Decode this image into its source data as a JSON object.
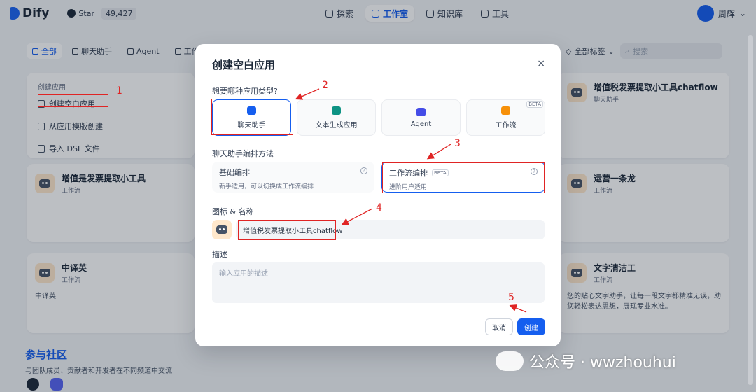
{
  "brand": {
    "name": "Dify",
    "star_label": "Star",
    "star_count": "49,427"
  },
  "nav": [
    {
      "label": "探索",
      "active": false
    },
    {
      "label": "工作室",
      "active": true
    },
    {
      "label": "知识库",
      "active": false
    },
    {
      "label": "工具",
      "active": false
    }
  ],
  "user": {
    "name": "周辉"
  },
  "filters": [
    {
      "label": "全部",
      "active": true
    },
    {
      "label": "聊天助手",
      "active": false
    },
    {
      "label": "Agent",
      "active": false
    },
    {
      "label": "工作流",
      "active": false
    }
  ],
  "tags_label": "全部标签",
  "search_placeholder": "搜索",
  "create_card": {
    "title": "创建应用",
    "options": [
      "创建空白应用",
      "从应用模版创建",
      "导入 DSL 文件"
    ]
  },
  "apps": {
    "a1": {
      "name": "增值是发票提取小工具",
      "type": "工作流"
    },
    "a2": {
      "name": "中译英",
      "type": "工作流",
      "desc": "中译英"
    },
    "a3": {
      "name": "增值税发票提取小工具chatflow",
      "type": "聊天助手"
    },
    "a4": {
      "name": "运营一条龙",
      "type": "工作流"
    },
    "a5": {
      "name": "文字清洁工",
      "type": "工作流",
      "desc": "您的贴心文字助手，让每一段文字都精准无误，助您轻松表达思想，展现专业水准。"
    }
  },
  "community": {
    "title": "参与社区",
    "desc": "与团队成员、贡献者和开发者在不同频道中交流"
  },
  "modal": {
    "title": "创建空白应用",
    "close": "×",
    "type_label": "想要哪种应用类型?",
    "types": [
      {
        "label": "聊天助手",
        "color": "#155eef",
        "selected": true
      },
      {
        "label": "文本生成应用",
        "color": "#0e9384",
        "selected": false
      },
      {
        "label": "Agent",
        "color": "#444ce7",
        "selected": false
      },
      {
        "label": "工作流",
        "color": "#f79009",
        "selected": false,
        "badge": "BETA"
      }
    ],
    "method_label": "聊天助手编排方法",
    "methods": [
      {
        "title": "基础编排",
        "desc": "新手适用，可以切换成工作流编排",
        "selected": false
      },
      {
        "title": "工作流编排",
        "badge": "BETA",
        "desc": "进阶用户适用",
        "selected": true
      }
    ],
    "name_label": "图标 & 名称",
    "name_value": "增值税发票提取小工具chatflow",
    "desc_label": "描述",
    "desc_placeholder": "输入应用的描述",
    "cancel": "取消",
    "create": "创建"
  },
  "annotations": [
    "1",
    "2",
    "3",
    "4",
    "5"
  ],
  "watermark": "公众号 · wwzhouhui",
  "colors": {
    "accent": "#155eef",
    "annotation": "#e02424"
  }
}
